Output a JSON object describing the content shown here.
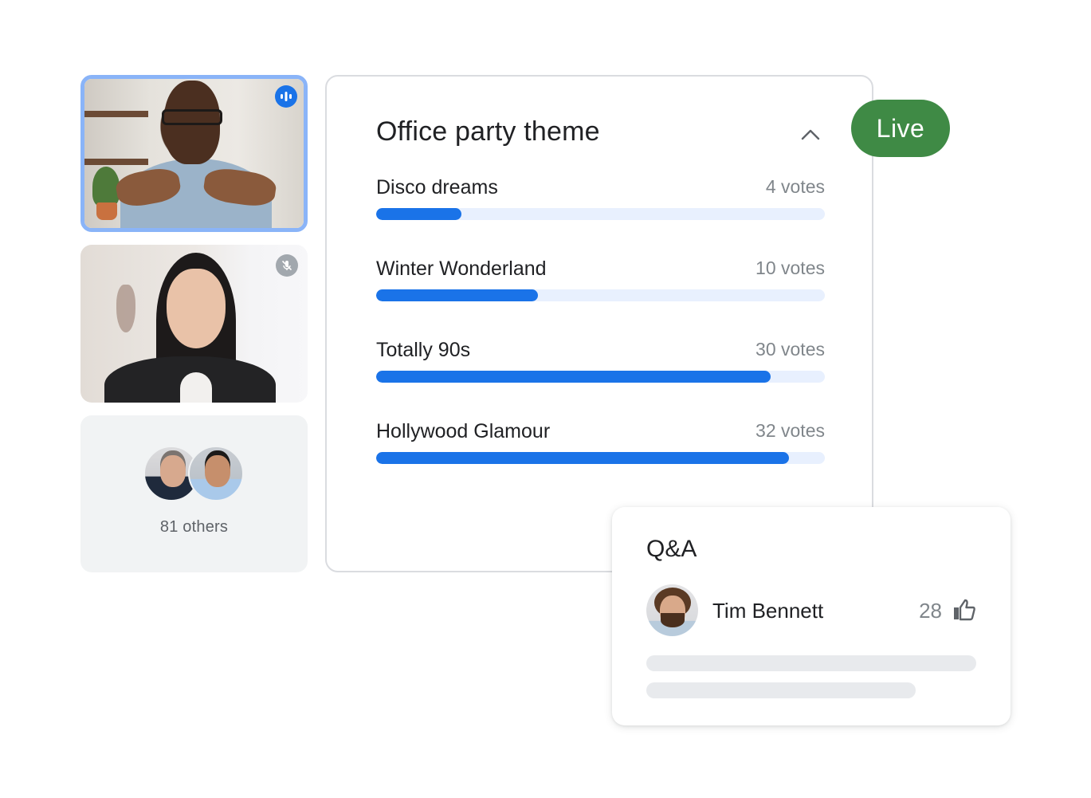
{
  "participants": {
    "tiles": [
      {
        "name": "Presenter speaking",
        "status": "speaking",
        "status_icon": "audio-wave-icon"
      },
      {
        "name": "Participant muted",
        "status": "muted",
        "status_icon": "mic-off-icon"
      }
    ],
    "others": {
      "label": "81 others",
      "count": 81
    }
  },
  "poll": {
    "title": "Office party theme",
    "collapse_icon": "chevron-up-icon",
    "options": [
      {
        "label": "Disco dreams",
        "votes_label": "4 votes",
        "votes": 4,
        "fill_percent": 19
      },
      {
        "label": "Winter Wonderland",
        "votes_label": "10 votes",
        "votes": 10,
        "fill_percent": 36
      },
      {
        "label": "Totally 90s",
        "votes_label": "30 votes",
        "votes": 30,
        "fill_percent": 88
      },
      {
        "label": "Hollywood Glamour",
        "votes_label": "32 votes",
        "votes": 32,
        "fill_percent": 92
      }
    ]
  },
  "live_badge": {
    "label": "Live",
    "color": "#3f8a45"
  },
  "qa": {
    "title": "Q&A",
    "question": {
      "author": "Tim Bennett",
      "upvotes": "28",
      "upvote_icon": "thumb-up-icon"
    }
  },
  "colors": {
    "accent": "#1a73e8",
    "bar_track": "#e8f0fe",
    "speaking_border": "#8ab4f8",
    "muted_text": "#80868b"
  }
}
